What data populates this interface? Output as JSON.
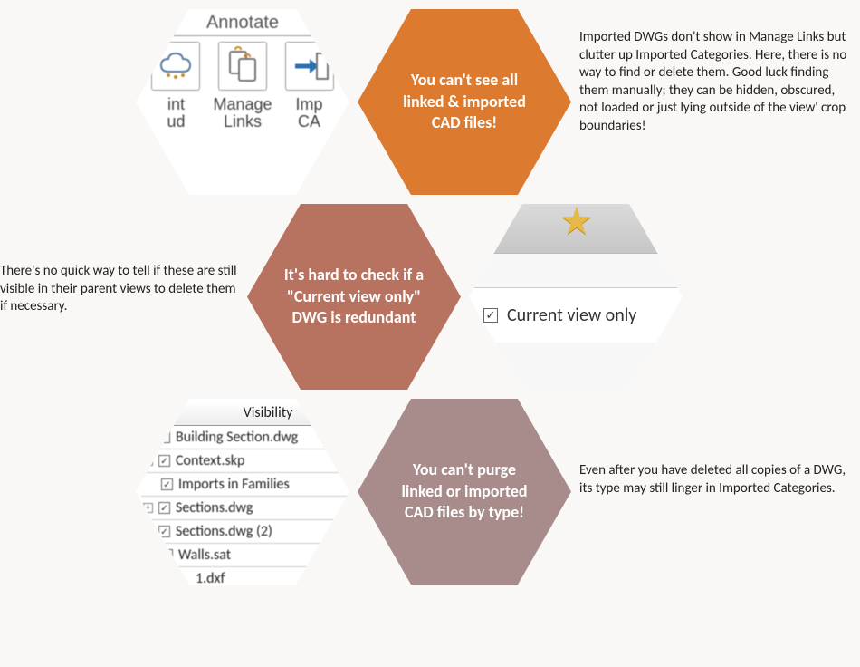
{
  "hex1": {
    "text": "You can't see all linked & imported CAD files!"
  },
  "hex2": {
    "text": "It's hard to check if a \"Current view only\" DWG is redundant"
  },
  "hex3": {
    "text": "You can't purge linked or imported CAD files by type!"
  },
  "side": {
    "right1": "Imported DWGs don't show in Manage Links but clutter up Imported Categories. Here, there is no way to find or delete them. Good luck finding them manually; they can be hidden, obscured, not loaded or just lying outside of the view' crop boundaries!",
    "left2": "There's no quick way to tell if these are still visible in their parent views to delete them if necessary.",
    "right3": "Even after you have deleted all copies of a DWG, its type may still linger in Imported Categories."
  },
  "toolbar": {
    "tab": "Annotate",
    "items": [
      {
        "line1": "int",
        "line2": "ud"
      },
      {
        "line1": "Manage",
        "line2": "Links"
      },
      {
        "line1": "Imp",
        "line2": "CA"
      }
    ]
  },
  "cvo": {
    "label": "Current view only",
    "checked": true
  },
  "visibility": {
    "header": "Visibility",
    "rows": [
      {
        "name": "Building Section.dwg",
        "expand": true
      },
      {
        "name": "Context.skp",
        "expand": true
      },
      {
        "name": "Imports in Families",
        "expand": false
      },
      {
        "name": "Sections.dwg",
        "expand": true
      },
      {
        "name": "Sections.dwg (2)",
        "expand": true
      },
      {
        "name": "Walls.sat",
        "expand": false
      },
      {
        "name": "1.dxf",
        "expand": false
      }
    ]
  },
  "colors": {
    "orange": "#dc7a2f",
    "brown": "#b87260",
    "mauve": "#a88c8c"
  }
}
